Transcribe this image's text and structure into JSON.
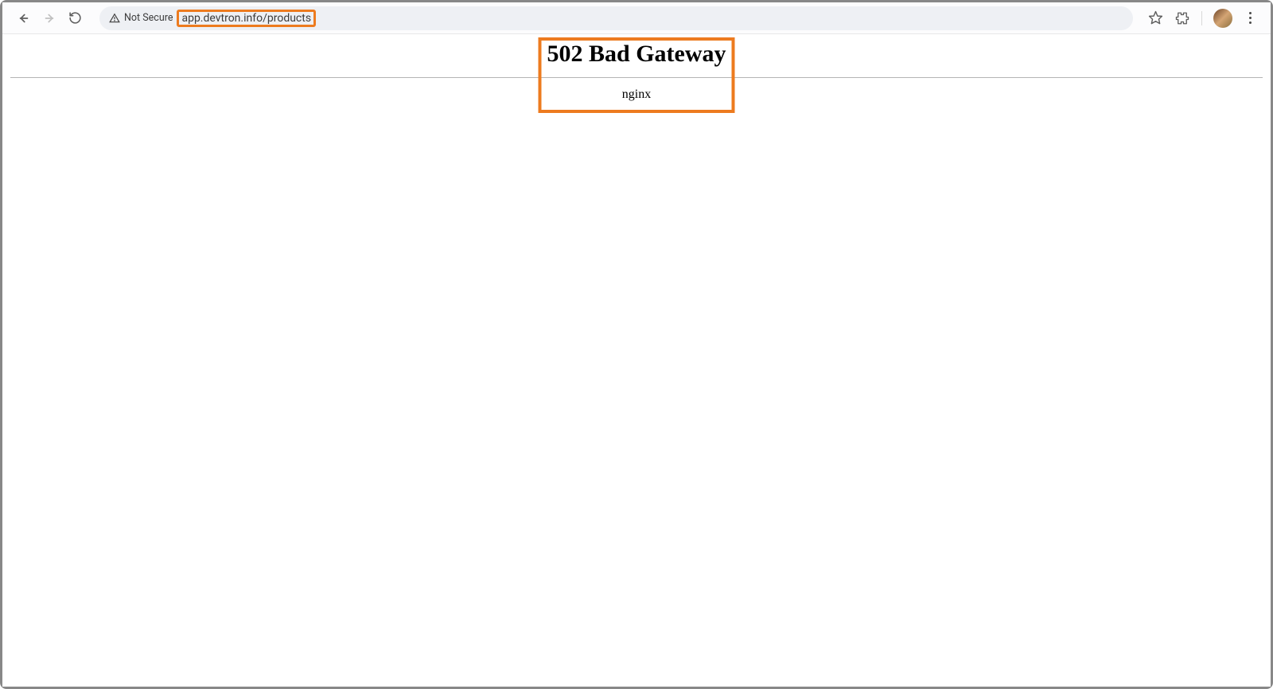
{
  "browser": {
    "security_label": "Not Secure",
    "url": "app.devtron.info/products"
  },
  "page": {
    "error_heading": "502 Bad Gateway",
    "server": "nginx"
  }
}
